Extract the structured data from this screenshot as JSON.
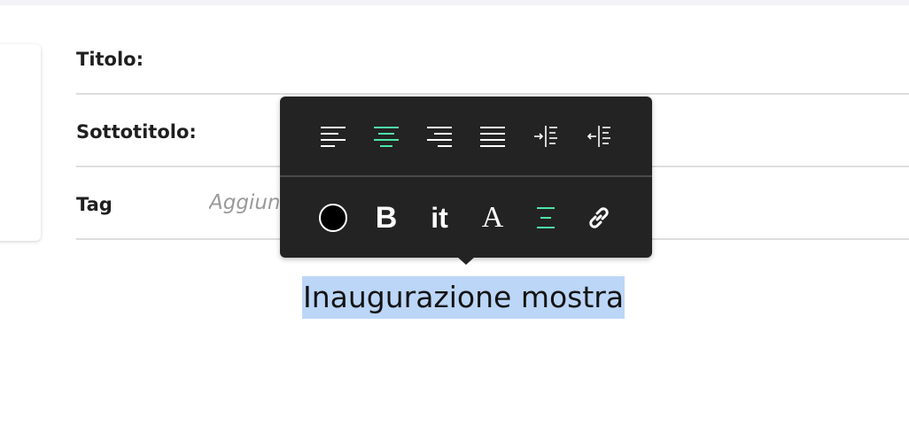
{
  "form": {
    "title_label": "Titolo:",
    "subtitle_label": "Sottotitolo:",
    "tag_label": "Tag",
    "tag_placeholder": "Aggiungi"
  },
  "toolbar": {
    "accent_color": "#4ee6a8",
    "background": "#232323",
    "alignment_buttons": [
      {
        "icon": "align-left-icon",
        "active": false
      },
      {
        "icon": "align-center-icon",
        "active": true
      },
      {
        "icon": "align-right-icon",
        "active": false
      },
      {
        "icon": "align-justify-icon",
        "active": false
      },
      {
        "icon": "indent-increase-icon",
        "active": false
      },
      {
        "icon": "indent-decrease-icon",
        "active": false
      }
    ],
    "format_buttons": [
      {
        "icon": "text-color-icon",
        "color": "#000000"
      },
      {
        "icon": "bold-icon",
        "glyph": "B"
      },
      {
        "icon": "italic-icon",
        "glyph": "it"
      },
      {
        "icon": "font-family-icon",
        "glyph": "A"
      },
      {
        "icon": "line-spacing-icon",
        "active": true
      },
      {
        "icon": "link-icon"
      }
    ]
  },
  "editor": {
    "selected_text": "Inaugurazione mostra",
    "selection_color": "#bcd6f8"
  }
}
